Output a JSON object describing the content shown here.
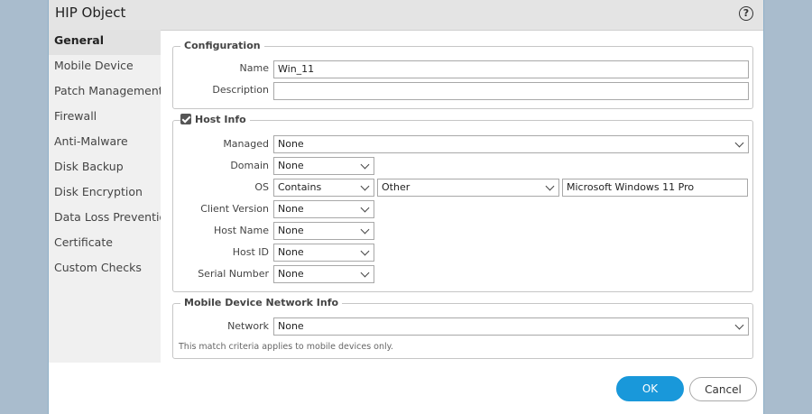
{
  "dialog": {
    "title": "HIP Object",
    "help_icon": "?"
  },
  "sidebar": {
    "items": [
      {
        "label": "General"
      },
      {
        "label": "Mobile Device"
      },
      {
        "label": "Patch Management"
      },
      {
        "label": "Firewall"
      },
      {
        "label": "Anti-Malware"
      },
      {
        "label": "Disk Backup"
      },
      {
        "label": "Disk Encryption"
      },
      {
        "label": "Data Loss Prevention"
      },
      {
        "label": "Certificate"
      },
      {
        "label": "Custom Checks"
      }
    ]
  },
  "configuration": {
    "legend": "Configuration",
    "name_label": "Name",
    "name_value": "Win_11",
    "description_label": "Description",
    "description_value": ""
  },
  "host_info": {
    "legend": "Host Info",
    "checked": true,
    "managed_label": "Managed",
    "managed_value": "None",
    "domain_label": "Domain",
    "domain_value": "None",
    "os_label": "OS",
    "os_operator": "Contains",
    "os_vendor": "Other",
    "os_value": "Microsoft Windows 11 Pro",
    "client_version_label": "Client Version",
    "client_version_value": "None",
    "host_name_label": "Host Name",
    "host_name_value": "None",
    "host_id_label": "Host ID",
    "host_id_value": "None",
    "serial_number_label": "Serial Number",
    "serial_number_value": "None"
  },
  "mobile_network": {
    "legend": "Mobile Device Network Info",
    "network_label": "Network",
    "network_value": "None",
    "note": "This match criteria applies to mobile devices only."
  },
  "footer": {
    "ok_label": "OK",
    "cancel_label": "Cancel"
  },
  "colors": {
    "accent": "#1998da",
    "backdrop": "#a9bccd"
  }
}
